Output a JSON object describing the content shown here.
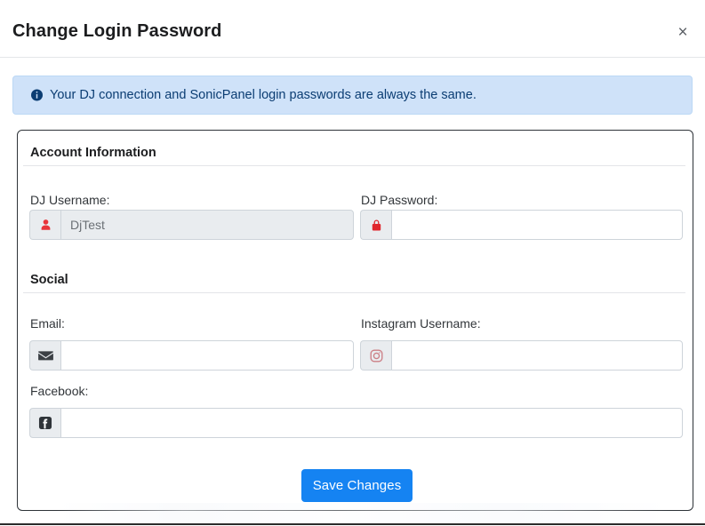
{
  "modal": {
    "title": "Change Login Password",
    "close_label": "×",
    "close_icon": "close-icon"
  },
  "alert": {
    "icon": "info-circle-icon",
    "text": "Your DJ connection and SonicPanel login passwords are always the same.",
    "background_color": "#cfe2f9",
    "text_color": "#0b3d73"
  },
  "sections": [
    {
      "title": "Account Information",
      "fields": [
        {
          "label": "DJ Username:",
          "icon": "user-icon",
          "icon_color": "#e8353a",
          "value": "DjTest",
          "placeholder": "",
          "disabled": true,
          "type": "text"
        },
        {
          "label": "DJ Password:",
          "icon": "lock-icon",
          "icon_color": "#e0262c",
          "value": "",
          "placeholder": "",
          "disabled": false,
          "type": "password"
        }
      ]
    },
    {
      "title": "Social",
      "fields": [
        {
          "label": "Email:",
          "icon": "envelope-icon",
          "icon_color": "#3b4045",
          "value": "",
          "placeholder": "",
          "disabled": false,
          "type": "text"
        },
        {
          "label": "Instagram Username:",
          "icon": "instagram-icon",
          "icon_color": "#cc7f86",
          "value": "",
          "placeholder": "",
          "disabled": false,
          "type": "text"
        },
        {
          "label": "Facebook:",
          "icon": "facebook-icon",
          "icon_color": "#2f3439",
          "value": "",
          "placeholder": "",
          "disabled": false,
          "type": "text"
        }
      ]
    }
  ],
  "footer": {
    "save_label": "Save Changes",
    "save_color": "#1583f2"
  }
}
